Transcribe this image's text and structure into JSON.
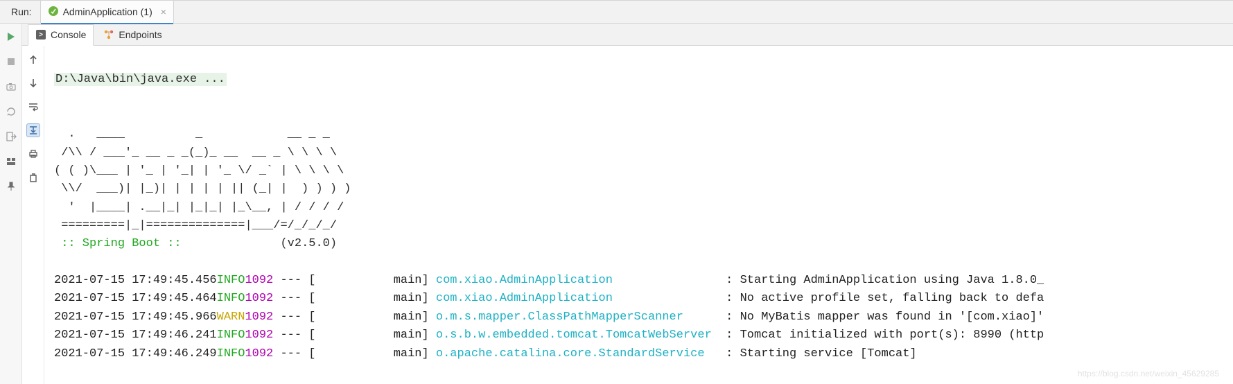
{
  "topbar": {
    "run_label": "Run:",
    "tab_label": "AdminApplication (1)"
  },
  "subtabs": {
    "console": "Console",
    "endpoints": "Endpoints"
  },
  "console": {
    "cmd": "D:\\Java\\bin\\java.exe ...",
    "banner": [
      "  .   ____          _            __ _ _",
      " /\\\\ / ___'_ __ _ _(_)_ __  __ _ \\ \\ \\ \\",
      "( ( )\\___ | '_ | '_| | '_ \\/ _` | \\ \\ \\ \\",
      " \\\\/  ___)| |_)| | | | | || (_| |  ) ) ) )",
      "  '  |____| .__|_| |_|_| |_\\__, | / / / /",
      " =========|_|==============|___/=/_/_/_/"
    ],
    "spring_boot_label": " :: Spring Boot :: ",
    "spring_boot_version": "(v2.5.0)",
    "logs": [
      {
        "ts": "2021-07-15 17:49:45.456",
        "level": "INFO",
        "pid": "1092",
        "thread": "main",
        "logger": "com.xiao.AdminApplication",
        "msg": "Starting AdminApplication using Java 1.8.0_"
      },
      {
        "ts": "2021-07-15 17:49:45.464",
        "level": "INFO",
        "pid": "1092",
        "thread": "main",
        "logger": "com.xiao.AdminApplication",
        "msg": "No active profile set, falling back to defa"
      },
      {
        "ts": "2021-07-15 17:49:45.966",
        "level": "WARN",
        "pid": "1092",
        "thread": "main",
        "logger": "o.m.s.mapper.ClassPathMapperScanner",
        "msg": "No MyBatis mapper was found in '[com.xiao]'"
      },
      {
        "ts": "2021-07-15 17:49:46.241",
        "level": "INFO",
        "pid": "1092",
        "thread": "main",
        "logger": "o.s.b.w.embedded.tomcat.TomcatWebServer",
        "msg": "Tomcat initialized with port(s): 8990 (http"
      },
      {
        "ts": "2021-07-15 17:49:46.249",
        "level": "INFO",
        "pid": "1092",
        "thread": "main",
        "logger": "o.apache.catalina.core.StandardService",
        "msg": "Starting service [Tomcat]"
      }
    ]
  },
  "watermark": "https://blog.csdn.net/weixin_45629285"
}
